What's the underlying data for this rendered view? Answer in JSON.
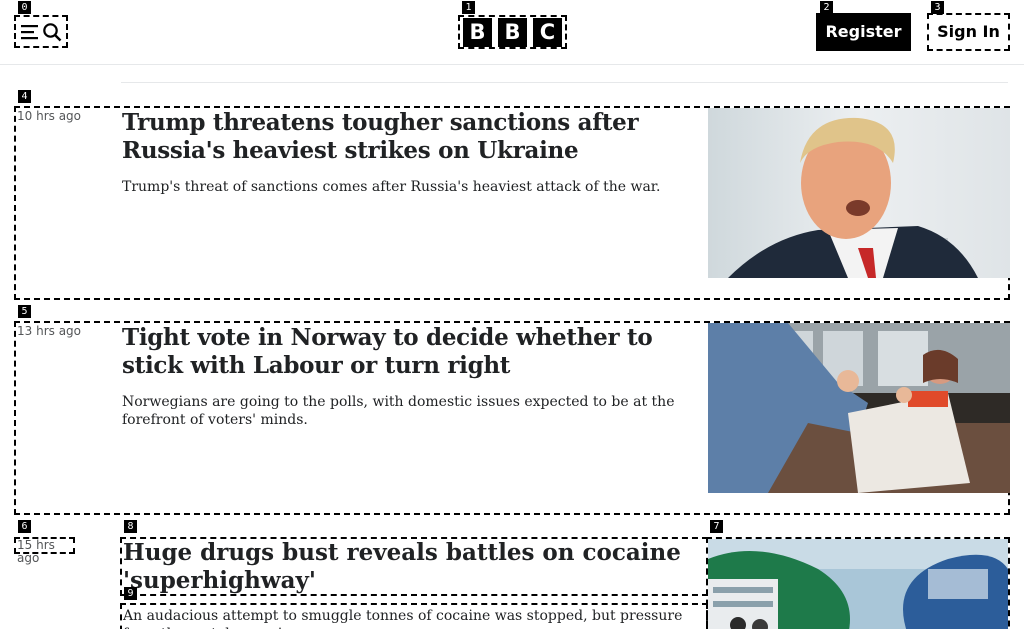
{
  "header": {
    "logo_letters": [
      "B",
      "B",
      "C"
    ],
    "register_label": "Register",
    "signin_label": "Sign In"
  },
  "markers": [
    "0",
    "1",
    "2",
    "3",
    "4",
    "5",
    "6",
    "7",
    "8",
    "9"
  ],
  "articles": [
    {
      "timestamp": "10 hrs ago",
      "headline": "Trump threatens tougher sanctions after Russia's heaviest strikes on Ukraine",
      "summary": "Trump's threat of sanctions comes after Russia's heaviest attack of the war."
    },
    {
      "timestamp": "13 hrs ago",
      "headline": "Tight vote in Norway to decide whether to stick with Labour or turn right",
      "summary": "Norwegians are going to the polls, with domestic issues expected to be at the forefront of voters' minds."
    },
    {
      "timestamp": "15 hrs ago",
      "headline": "Huge drugs bust reveals battles on cocaine 'superhighway'",
      "summary": "An audacious attempt to smuggle tonnes of cocaine was stopped, but pressure from the cartels remains."
    }
  ],
  "icons": {
    "menu": "menu-icon",
    "search": "search-icon"
  },
  "colors": {
    "brand": "#000000",
    "text": "#202224",
    "meta": "#545658"
  }
}
